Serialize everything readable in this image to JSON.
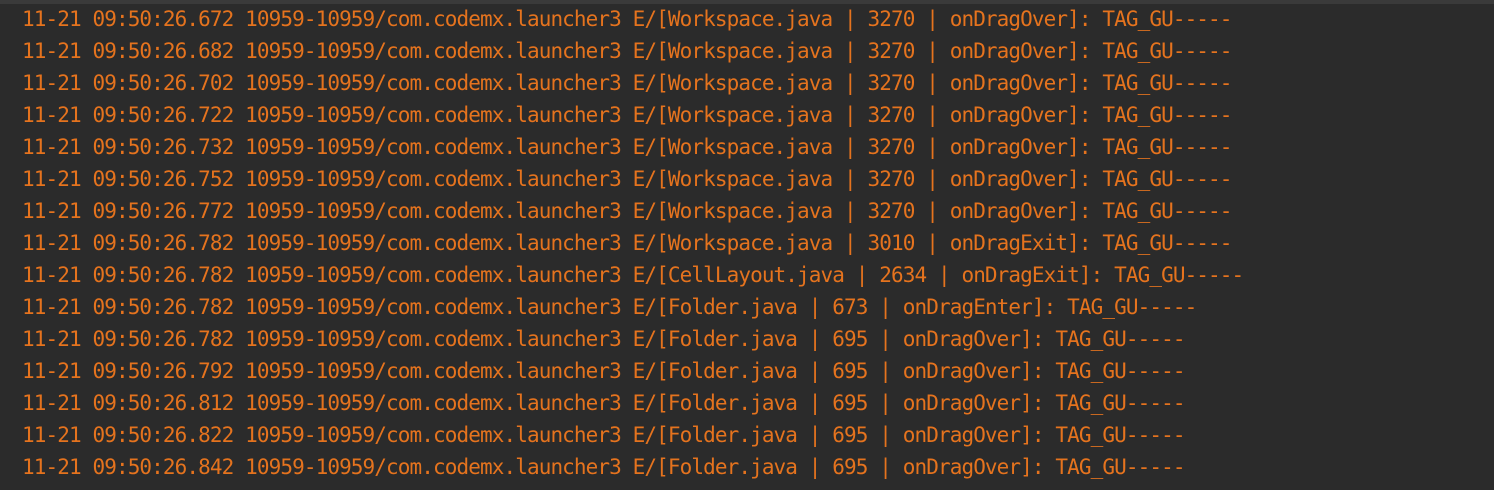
{
  "log": {
    "color": "#e5731e",
    "background": "#2b2b2b",
    "lines": [
      "11-21 09:50:26.672 10959-10959/com.codemx.launcher3 E/[Workspace.java | 3270 | onDragOver]: TAG_GU-----",
      "11-21 09:50:26.682 10959-10959/com.codemx.launcher3 E/[Workspace.java | 3270 | onDragOver]: TAG_GU-----",
      "11-21 09:50:26.702 10959-10959/com.codemx.launcher3 E/[Workspace.java | 3270 | onDragOver]: TAG_GU-----",
      "11-21 09:50:26.722 10959-10959/com.codemx.launcher3 E/[Workspace.java | 3270 | onDragOver]: TAG_GU-----",
      "11-21 09:50:26.732 10959-10959/com.codemx.launcher3 E/[Workspace.java | 3270 | onDragOver]: TAG_GU-----",
      "11-21 09:50:26.752 10959-10959/com.codemx.launcher3 E/[Workspace.java | 3270 | onDragOver]: TAG_GU-----",
      "11-21 09:50:26.772 10959-10959/com.codemx.launcher3 E/[Workspace.java | 3270 | onDragOver]: TAG_GU-----",
      "11-21 09:50:26.782 10959-10959/com.codemx.launcher3 E/[Workspace.java | 3010 | onDragExit]: TAG_GU-----",
      "11-21 09:50:26.782 10959-10959/com.codemx.launcher3 E/[CellLayout.java | 2634 | onDragExit]: TAG_GU-----",
      "11-21 09:50:26.782 10959-10959/com.codemx.launcher3 E/[Folder.java | 673 | onDragEnter]: TAG_GU-----",
      "11-21 09:50:26.782 10959-10959/com.codemx.launcher3 E/[Folder.java | 695 | onDragOver]: TAG_GU-----",
      "11-21 09:50:26.792 10959-10959/com.codemx.launcher3 E/[Folder.java | 695 | onDragOver]: TAG_GU-----",
      "11-21 09:50:26.812 10959-10959/com.codemx.launcher3 E/[Folder.java | 695 | onDragOver]: TAG_GU-----",
      "11-21 09:50:26.822 10959-10959/com.codemx.launcher3 E/[Folder.java | 695 | onDragOver]: TAG_GU-----",
      "11-21 09:50:26.842 10959-10959/com.codemx.launcher3 E/[Folder.java | 695 | onDragOver]: TAG_GU-----"
    ]
  }
}
